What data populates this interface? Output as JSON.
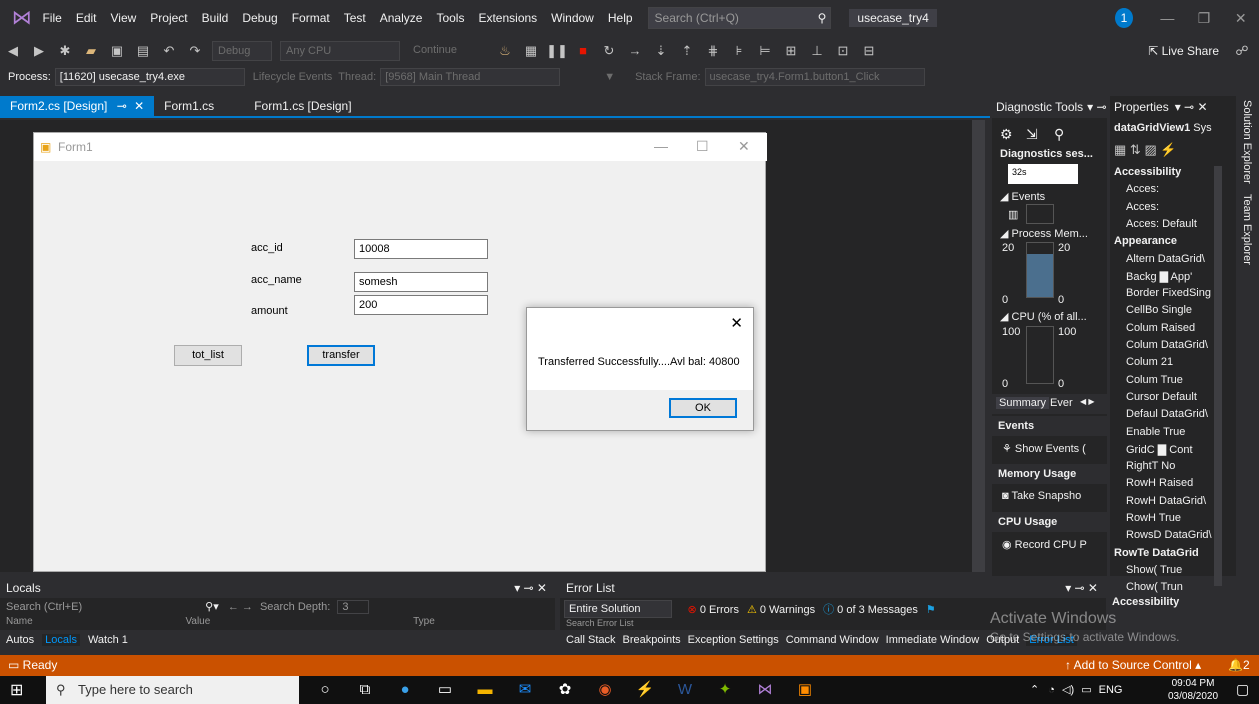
{
  "menu": {
    "items": [
      "File",
      "Edit",
      "View",
      "Project",
      "Build",
      "Debug",
      "Format",
      "Test",
      "Analyze",
      "Tools",
      "Extensions",
      "Window",
      "Help"
    ],
    "search_placeholder": "Search (Ctrl+Q)",
    "solution_name": "usecase_try4",
    "notification_count": "1"
  },
  "toolbar": {
    "config": "Debug",
    "platform": "Any CPU",
    "continue_label": "Continue",
    "live_share": "Live Share"
  },
  "process_bar": {
    "process_label": "Process:",
    "process_value": "[11620] usecase_try4.exe",
    "lifecycle": "Lifecycle Events",
    "thread_label": "Thread:",
    "thread_value": "[9568] Main Thread",
    "stack_label": "Stack Frame:",
    "stack_value": "usecase_try4.Form1.button1_Click"
  },
  "doc_tabs": [
    {
      "label": "Form2.cs [Design]",
      "active": true
    },
    {
      "label": "Form1.cs",
      "active": false
    },
    {
      "label": "Form1.cs [Design]",
      "active": false
    }
  ],
  "form1": {
    "title": "Form1",
    "acc_id_label": "acc_id",
    "acc_id_value": "10008",
    "acc_name_label": "acc_name",
    "acc_name_value": "somesh",
    "amount_label": "amount",
    "amount_value": "200",
    "tot_list_button": "tot_list",
    "transfer_button": "transfer"
  },
  "dialog": {
    "message": "Transferred Successfully....Avl bal: 40800",
    "ok_button": "OK"
  },
  "diagnostics": {
    "title": "Diagnostic Tools",
    "session": "Diagnostics ses...",
    "timer": "32s",
    "events": "Events",
    "process_memory": "Process Mem...",
    "mem_max_left": "20",
    "mem_max_right": "20",
    "mem_min_left": "0",
    "mem_min_right": "0",
    "cpu": "CPU (% of all...",
    "cpu_max_left": "100",
    "cpu_max_right": "100",
    "cpu_min_left": "0",
    "cpu_min_right": "0",
    "tab_summary": "Summary",
    "tab_events": "Ever",
    "sec_events": "Events",
    "show_events": "Show Events (",
    "sec_memory": "Memory Usage",
    "take_snapshot": "Take Snapsho",
    "sec_cpu": "CPU Usage",
    "record_cpu": "Record CPU P"
  },
  "properties": {
    "title": "Properties",
    "object": "dataGridView1",
    "object_type": "Sys",
    "rows": [
      {
        "kind": "cat",
        "text": "Accessibility"
      },
      {
        "kind": "row",
        "text": "Acces:"
      },
      {
        "kind": "row",
        "text": "Acces:"
      },
      {
        "kind": "row",
        "text": "Acces: Default"
      },
      {
        "kind": "cat",
        "text": "Appearance"
      },
      {
        "kind": "row",
        "text": "Altern DataGrid\\"
      },
      {
        "kind": "row",
        "text": "Backg ▇ App'"
      },
      {
        "kind": "row",
        "text": "Border FixedSing"
      },
      {
        "kind": "row",
        "text": "CellBo Single"
      },
      {
        "kind": "row",
        "text": "Colum Raised"
      },
      {
        "kind": "row",
        "text": "Colum DataGrid\\"
      },
      {
        "kind": "row",
        "text": "Colum 21"
      },
      {
        "kind": "row",
        "text": "Colum True"
      },
      {
        "kind": "row",
        "text": "Cursor Default"
      },
      {
        "kind": "row",
        "text": "Defaul DataGrid\\"
      },
      {
        "kind": "row",
        "text": "Enable True"
      },
      {
        "kind": "row",
        "text": "GridC ▇ Cont"
      },
      {
        "kind": "row",
        "text": "RightT No"
      },
      {
        "kind": "row",
        "text": "RowH Raised"
      },
      {
        "kind": "row",
        "text": "RowH DataGrid\\"
      },
      {
        "kind": "row",
        "text": "RowH True"
      },
      {
        "kind": "row",
        "text": "RowsD DataGrid\\"
      },
      {
        "kind": "cat",
        "text": "RowTe DataGrid"
      },
      {
        "kind": "row",
        "text": "Show( True"
      },
      {
        "kind": "row",
        "text": "Chow( Trun"
      }
    ],
    "description": "Accessibility"
  },
  "side_tabs": [
    "Solution Explorer",
    "Team Explorer"
  ],
  "locals": {
    "title": "Locals",
    "search_placeholder": "Search (Ctrl+E)",
    "search_depth": "Search Depth:",
    "depth_value": "3",
    "col_name": "Name",
    "col_value": "Value",
    "col_type": "Type",
    "tabs": [
      "Autos",
      "Locals",
      "Watch 1"
    ]
  },
  "error_list": {
    "title": "Error List",
    "scope": "Entire Solution",
    "errors": "0 Errors",
    "warnings": "0 Warnings",
    "messages": "0 of 3 Messages",
    "search_placeholder": "Search Error List",
    "tabs": [
      "Call Stack",
      "Breakpoints",
      "Exception Settings",
      "Command Window",
      "Immediate Window",
      "Output",
      "Error List"
    ]
  },
  "watermark": {
    "line1": "Activate Windows",
    "line2": "Go to Settings to activate Windows."
  },
  "status": {
    "ready": "Ready",
    "source_control": "Add to Source Control",
    "badge": "2"
  },
  "taskbar": {
    "search_placeholder": "Type here to search",
    "lang": "ENG",
    "time": "09:04 PM",
    "date": "03/08/2020"
  },
  "colors": {
    "accent": "#007acc",
    "status_bar": "#ca5100"
  }
}
